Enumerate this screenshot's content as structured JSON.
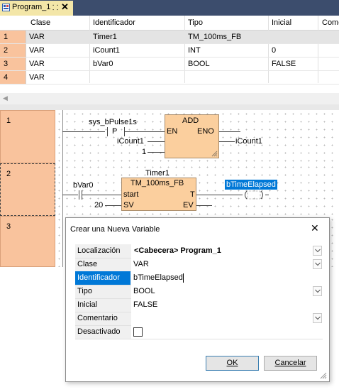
{
  "tab": {
    "title": "Program_1",
    "pin": "ⁱ",
    "close": "✕"
  },
  "var_table": {
    "headers": [
      "Clase",
      "Identificador",
      "Tipo",
      "Inicial",
      "Come"
    ],
    "rows": [
      {
        "num": "1",
        "clase": "VAR",
        "id": "Timer1",
        "tipo": "TM_100ms_FB",
        "inicial": ""
      },
      {
        "num": "2",
        "clase": "VAR",
        "id": "iCount1",
        "tipo": "INT",
        "inicial": "0"
      },
      {
        "num": "3",
        "clase": "VAR",
        "id": "bVar0",
        "tipo": "BOOL",
        "inicial": "FALSE"
      },
      {
        "num": "4",
        "clase": "VAR",
        "id": "",
        "tipo": "",
        "inicial": ""
      }
    ]
  },
  "scroll": {
    "left_arrow": "◀"
  },
  "networks": {
    "n1": {
      "num": "1",
      "contact_var": "sys_bPulse1s",
      "contact_type": "P",
      "block_name": "ADD",
      "pin_en": "EN",
      "pin_eno": "ENO",
      "in1": "iCount1",
      "in2": "1",
      "out": "iCount1"
    },
    "n2": {
      "num": "2",
      "instance": "Timer1",
      "block_type": "TM_100ms_FB",
      "contact_var": "bVar0",
      "pin_start": "start",
      "pin_t": "T",
      "pin_sv": "SV",
      "pin_ev": "EV",
      "sv_value": "20",
      "coil_var": "bTimeElapsed"
    },
    "n3": {
      "num": "3"
    }
  },
  "dialog": {
    "title": "Crear una Nueva Variable",
    "close": "✕",
    "rows": [
      {
        "label": "Localización",
        "value": "<Cabecera> Program_1",
        "dropdown": true
      },
      {
        "label": "Clase",
        "value": "VAR",
        "dropdown": true
      },
      {
        "label": "Identificador",
        "value": "bTimeElapsed",
        "dropdown": false
      },
      {
        "label": "Tipo",
        "value": "BOOL",
        "dropdown": true
      },
      {
        "label": "Inicial",
        "value": "FALSE",
        "dropdown": false
      },
      {
        "label": "Comentario",
        "value": "",
        "dropdown": true
      },
      {
        "label": "Desactivado",
        "value": "",
        "checkbox": true
      }
    ],
    "ok_label": "OK",
    "cancel_label": "Cancelar"
  },
  "colors": {
    "row_number_bg": "#f9c39d",
    "block_fill": "#fbcf9e",
    "selection_blue": "#0078d7",
    "tab_strip": "#3c4d6d"
  }
}
